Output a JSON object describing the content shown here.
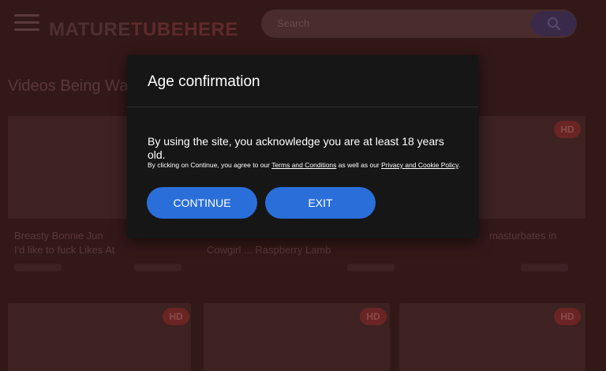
{
  "header": {
    "logo_main": "MATURE",
    "logo_accent": "TUBEHERE",
    "search_placeholder": "Search"
  },
  "main": {
    "section_title": "Videos Being Wa",
    "videos": [
      {
        "title": "Breasty Bonnie Jun",
        "title_line2": "I'd like to fuck Likes At",
        "hd": ""
      },
      {
        "title": "",
        "title_line2": "Cowgirl ... Raspberry Lamb",
        "hd": ""
      },
      {
        "title": "masturbates in",
        "title_line2": "",
        "hd": "HD"
      },
      {
        "title": "",
        "title_line2": "",
        "hd": "HD"
      },
      {
        "title": "",
        "title_line2": "",
        "hd": "HD"
      },
      {
        "title": "",
        "title_line2": "",
        "hd": "HD"
      }
    ]
  },
  "modal": {
    "title": "Age confirmation",
    "body": "By using the site, you acknowledge you are at least 18 years old.",
    "small_prefix": "By clicking on Continue, you agree to our ",
    "terms_link": "Terms and Conditions",
    "small_middle": " as well as our ",
    "privacy_link": "Privacy and Cookie Policy",
    "small_suffix": ".",
    "continue_label": "CONTINUE",
    "exit_label": "EXIT"
  },
  "colors": {
    "accent": "#2a6fd9",
    "modal_bg": "#161616",
    "overlay": "#331818"
  }
}
